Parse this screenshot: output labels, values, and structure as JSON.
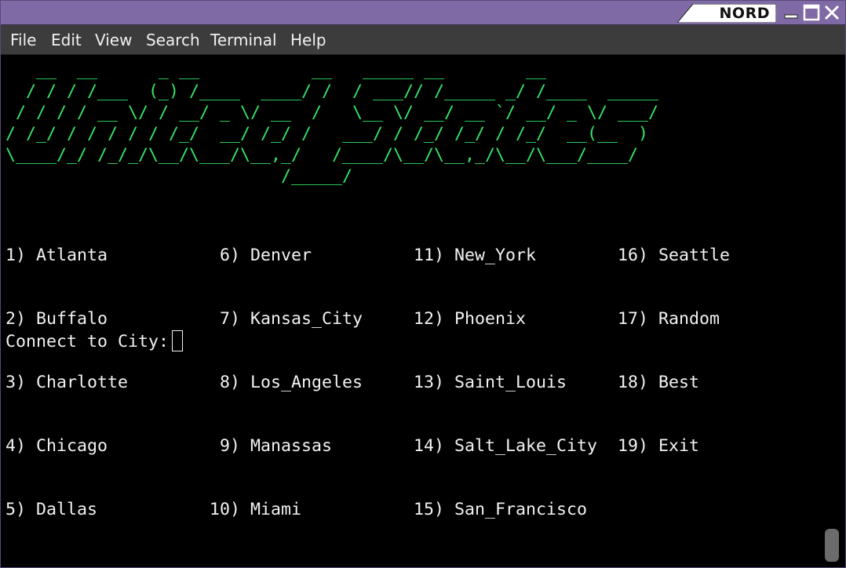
{
  "window": {
    "title": "NORD",
    "accent": "#7f6aa6"
  },
  "menu": [
    "File",
    "Edit",
    "View",
    "Search",
    "Terminal",
    "Help"
  ],
  "terminal": {
    "banner_lines": [
      "   __  __      _ __           __   _____ __        __",
      "  / / / /___  (_) /____  ____/ /  / ___// /_____ _/ /____  _____",
      " / / / / __ \\/ / __/ _ \\/ __  /   \\__ \\/ __/ __ `/ __/ _ \\/ ___/",
      "/ /_/ / / / / / /_/  __/ /_/ /   ___/ / /_/ /_/ / /_/  __(__  )",
      "\\____/_/ /_/_/\\__/\\___/\\__,_/   /____/\\__/\\__,_/\\__/\\___/____/",
      "                           /_____/"
    ],
    "banner_color": "#33e86a",
    "columns": [
      [
        "1) Atlanta",
        "2) Buffalo",
        "3) Charlotte",
        "4) Chicago",
        "5) Dallas"
      ],
      [
        " 6) Denver",
        " 7) Kansas_City",
        " 8) Los_Angeles",
        " 9) Manassas",
        "10) Miami"
      ],
      [
        "11) New_York",
        "12) Phoenix",
        "13) Saint_Louis",
        "14) Salt_Lake_City",
        "15) San_Francisco"
      ],
      [
        "16) Seattle",
        "17) Random",
        "18) Best",
        "19) Exit"
      ]
    ],
    "prompt": "Connect to City:"
  }
}
